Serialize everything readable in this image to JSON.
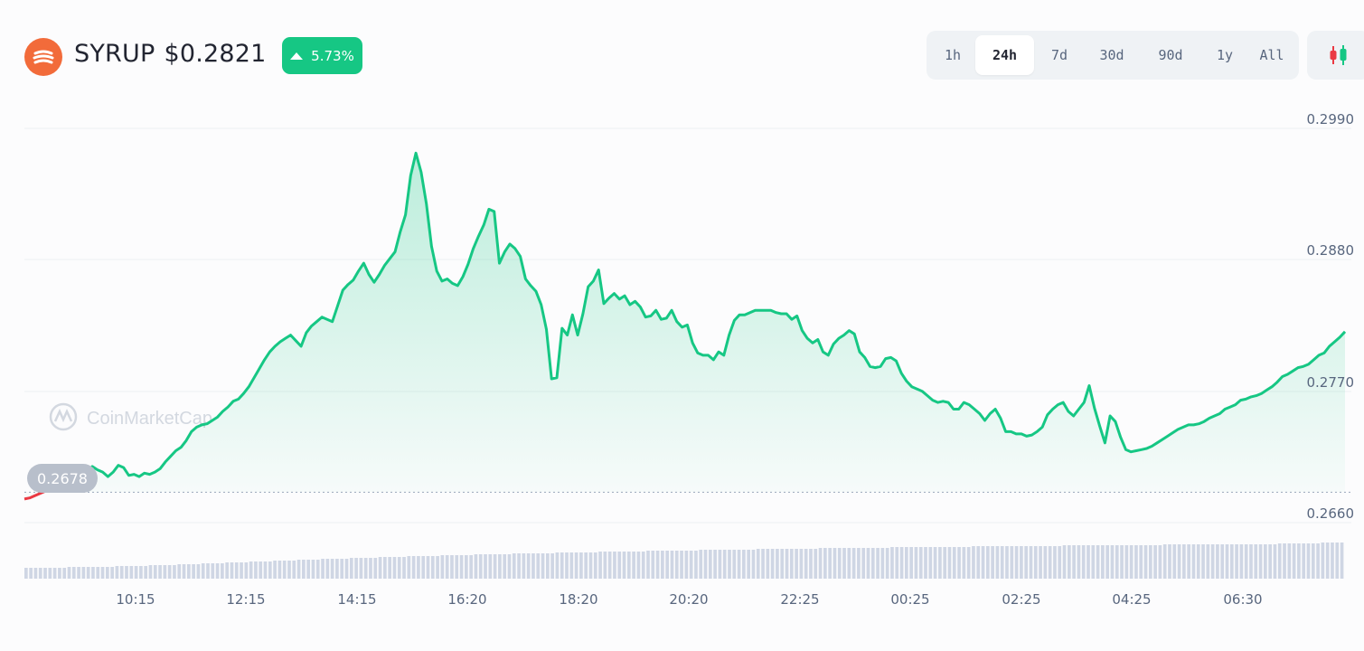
{
  "header": {
    "symbol": "SYRUP",
    "price": "$0.2821",
    "change": "5.73%",
    "logo_icon": "syrup-logo-icon"
  },
  "range_tabs": [
    {
      "label": "1h",
      "active": false
    },
    {
      "label": "24h",
      "active": true
    },
    {
      "label": "7d",
      "active": false
    },
    {
      "label": "30d",
      "active": false
    },
    {
      "label": "90d",
      "active": false
    },
    {
      "label": "1y",
      "active": false
    },
    {
      "label": "All",
      "active": false
    }
  ],
  "candle_toggle_icon": "candlestick-icon",
  "watermark": "CoinMarketCap",
  "reference_label": "0.2678",
  "colors": {
    "up": "#16c784",
    "down": "#ea3943",
    "volume": "#cfd6e4",
    "grid": "#eff2f5"
  },
  "chart_data": {
    "type": "area",
    "y_ticks": [
      "0.2990",
      "0.2880",
      "0.2770",
      "0.2660"
    ],
    "ylim": [
      0.2651,
      0.3002
    ],
    "x_ticks": [
      "10:15",
      "12:15",
      "14:15",
      "16:20",
      "18:20",
      "20:20",
      "22:25",
      "00:25",
      "02:25",
      "04:25",
      "06:30"
    ],
    "reference_value": 0.2678,
    "grid": true,
    "series": [
      {
        "values": [
          0.2672,
          0.2673,
          0.2675,
          0.2677,
          0.2679,
          0.2681,
          0.2683,
          0.2685,
          0.2686,
          0.2689,
          0.2688,
          0.2692,
          0.2696,
          0.2701,
          0.2698,
          0.2696,
          0.2692,
          0.2696,
          0.2702,
          0.27,
          0.2693,
          0.2694,
          0.2692,
          0.2695,
          0.2694,
          0.2696,
          0.2699,
          0.2705,
          0.271,
          0.2715,
          0.2718,
          0.2724,
          0.2732,
          0.2736,
          0.2738,
          0.2739,
          0.2742,
          0.2745,
          0.275,
          0.2754,
          0.2759,
          0.2761,
          0.2766,
          0.2772,
          0.278,
          0.2788,
          0.2796,
          0.2803,
          0.2808,
          0.2812,
          0.2815,
          0.2818,
          0.2813,
          0.2808,
          0.282,
          0.2826,
          0.283,
          0.2834,
          0.2832,
          0.283,
          0.2844,
          0.2858,
          0.2863,
          0.2867,
          0.2875,
          0.2882,
          0.2872,
          0.2865,
          0.2872,
          0.288,
          0.2886,
          0.2892,
          0.291,
          0.2925,
          0.296,
          0.298,
          0.2963,
          0.2935,
          0.2897,
          0.2875,
          0.2866,
          0.2868,
          0.2864,
          0.2862,
          0.287,
          0.2881,
          0.2895,
          0.2906,
          0.2916,
          0.293,
          0.2928,
          0.2882,
          0.2892,
          0.2899,
          0.2895,
          0.2888,
          0.2868,
          0.2862,
          0.2857,
          0.2845,
          0.2823,
          0.2779,
          0.278,
          0.2824,
          0.2818,
          0.2836,
          0.2818,
          0.2837,
          0.2861,
          0.2866,
          0.2876,
          0.2846,
          0.2851,
          0.2855,
          0.285,
          0.2853,
          0.2845,
          0.2848,
          0.2843,
          0.2834,
          0.2835,
          0.284,
          0.2832,
          0.2833,
          0.284,
          0.283,
          0.2825,
          0.2827,
          0.2811,
          0.2802,
          0.28,
          0.28,
          0.2796,
          0.2803,
          0.28,
          0.2818,
          0.2831,
          0.2836,
          0.2836,
          0.2838,
          0.284,
          0.284,
          0.284,
          0.284,
          0.2838,
          0.2837,
          0.2837,
          0.2832,
          0.2835,
          0.2822,
          0.2815,
          0.2811,
          0.2814,
          0.2803,
          0.28,
          0.281,
          0.2815,
          0.2818,
          0.2822,
          0.2819,
          0.2803,
          0.2798,
          0.279,
          0.2789,
          0.279,
          0.2797,
          0.2798,
          0.2795,
          0.2784,
          0.2777,
          0.2772,
          0.277,
          0.2768,
          0.2764,
          0.276,
          0.2758,
          0.2759,
          0.2758,
          0.2752,
          0.2752,
          0.2758,
          0.2756,
          0.2752,
          0.2748,
          0.2742,
          0.2748,
          0.2752,
          0.2744,
          0.2732,
          0.2732,
          0.273,
          0.273,
          0.2728,
          0.2729,
          0.2732,
          0.2736,
          0.2747,
          0.2752,
          0.2756,
          0.2758,
          0.275,
          0.2746,
          0.2752,
          0.2758,
          0.2773,
          0.2753,
          0.2737,
          0.2722,
          0.2746,
          0.2741,
          0.2727,
          0.2716,
          0.2714,
          0.2715,
          0.2716,
          0.2717,
          0.2719,
          0.2722,
          0.2725,
          0.2728,
          0.2731,
          0.2734,
          0.2736,
          0.2738,
          0.2738,
          0.2739,
          0.2741,
          0.2744,
          0.2746,
          0.2748,
          0.2752,
          0.2754,
          0.2756,
          0.276,
          0.2761,
          0.2763,
          0.2764,
          0.2766,
          0.2769,
          0.2772,
          0.2776,
          0.2781,
          0.2783,
          0.2786,
          0.2789,
          0.279,
          0.2792,
          0.2796,
          0.28,
          0.2802,
          0.2808,
          0.2812,
          0.2816,
          0.2821
        ]
      }
    ],
    "volume": [
      12,
      12,
      12,
      12,
      12,
      12,
      12,
      12,
      12,
      13,
      13,
      13,
      13,
      13,
      13,
      13,
      13,
      13,
      13,
      14,
      14,
      14,
      14,
      14,
      14,
      14,
      15,
      15,
      15,
      15,
      15,
      15,
      16,
      16,
      16,
      16,
      16,
      17,
      17,
      17,
      17,
      17,
      18,
      18,
      18,
      18,
      18,
      19,
      19,
      19,
      19,
      19,
      20,
      20,
      20,
      20,
      20,
      21,
      21,
      21,
      21,
      21,
      22,
      22,
      22,
      22,
      22,
      22,
      23,
      23,
      23,
      23,
      23,
      23,
      24,
      24,
      24,
      24,
      24,
      24,
      25,
      25,
      25,
      25,
      25,
      25,
      25,
      26,
      26,
      26,
      26,
      26,
      26,
      26,
      27,
      27,
      27,
      27,
      27,
      27,
      27,
      27,
      28,
      28,
      28,
      28,
      28,
      28,
      28,
      28,
      28,
      29,
      29,
      29,
      29,
      29,
      29,
      29,
      29,
      29,
      30,
      30,
      30,
      30,
      30,
      30,
      30,
      30,
      30,
      30,
      31,
      31,
      31,
      31,
      31,
      31,
      31,
      31,
      31,
      31,
      31,
      32,
      32,
      32,
      32,
      32,
      32,
      32,
      32,
      32,
      32,
      32,
      32,
      33,
      33,
      33,
      33,
      33,
      33,
      33,
      33,
      33,
      33,
      33,
      33,
      33,
      34,
      34,
      34,
      34,
      34,
      34,
      34,
      34,
      34,
      34,
      34,
      34,
      34,
      34,
      34,
      35,
      35,
      35,
      35,
      35,
      35,
      35,
      35,
      35,
      35,
      35,
      35,
      35,
      35,
      35,
      35,
      35,
      36,
      36,
      36,
      36,
      36,
      36,
      36,
      36,
      36,
      36,
      36,
      36,
      36,
      36,
      36,
      36,
      36,
      36,
      36,
      37,
      37,
      37,
      37,
      37,
      37,
      37,
      37,
      37,
      37,
      37,
      37,
      37,
      37,
      37,
      37,
      37,
      37,
      37,
      37,
      37,
      38,
      38,
      38,
      38,
      38,
      38,
      38,
      38,
      38,
      38,
      38,
      38,
      38,
      38,
      38,
      38,
      38,
      38,
      38,
      38,
      38,
      38,
      38,
      38,
      39,
      39,
      39,
      39,
      39,
      39,
      39,
      39,
      39,
      40,
      40,
      40,
      40,
      40
    ]
  }
}
